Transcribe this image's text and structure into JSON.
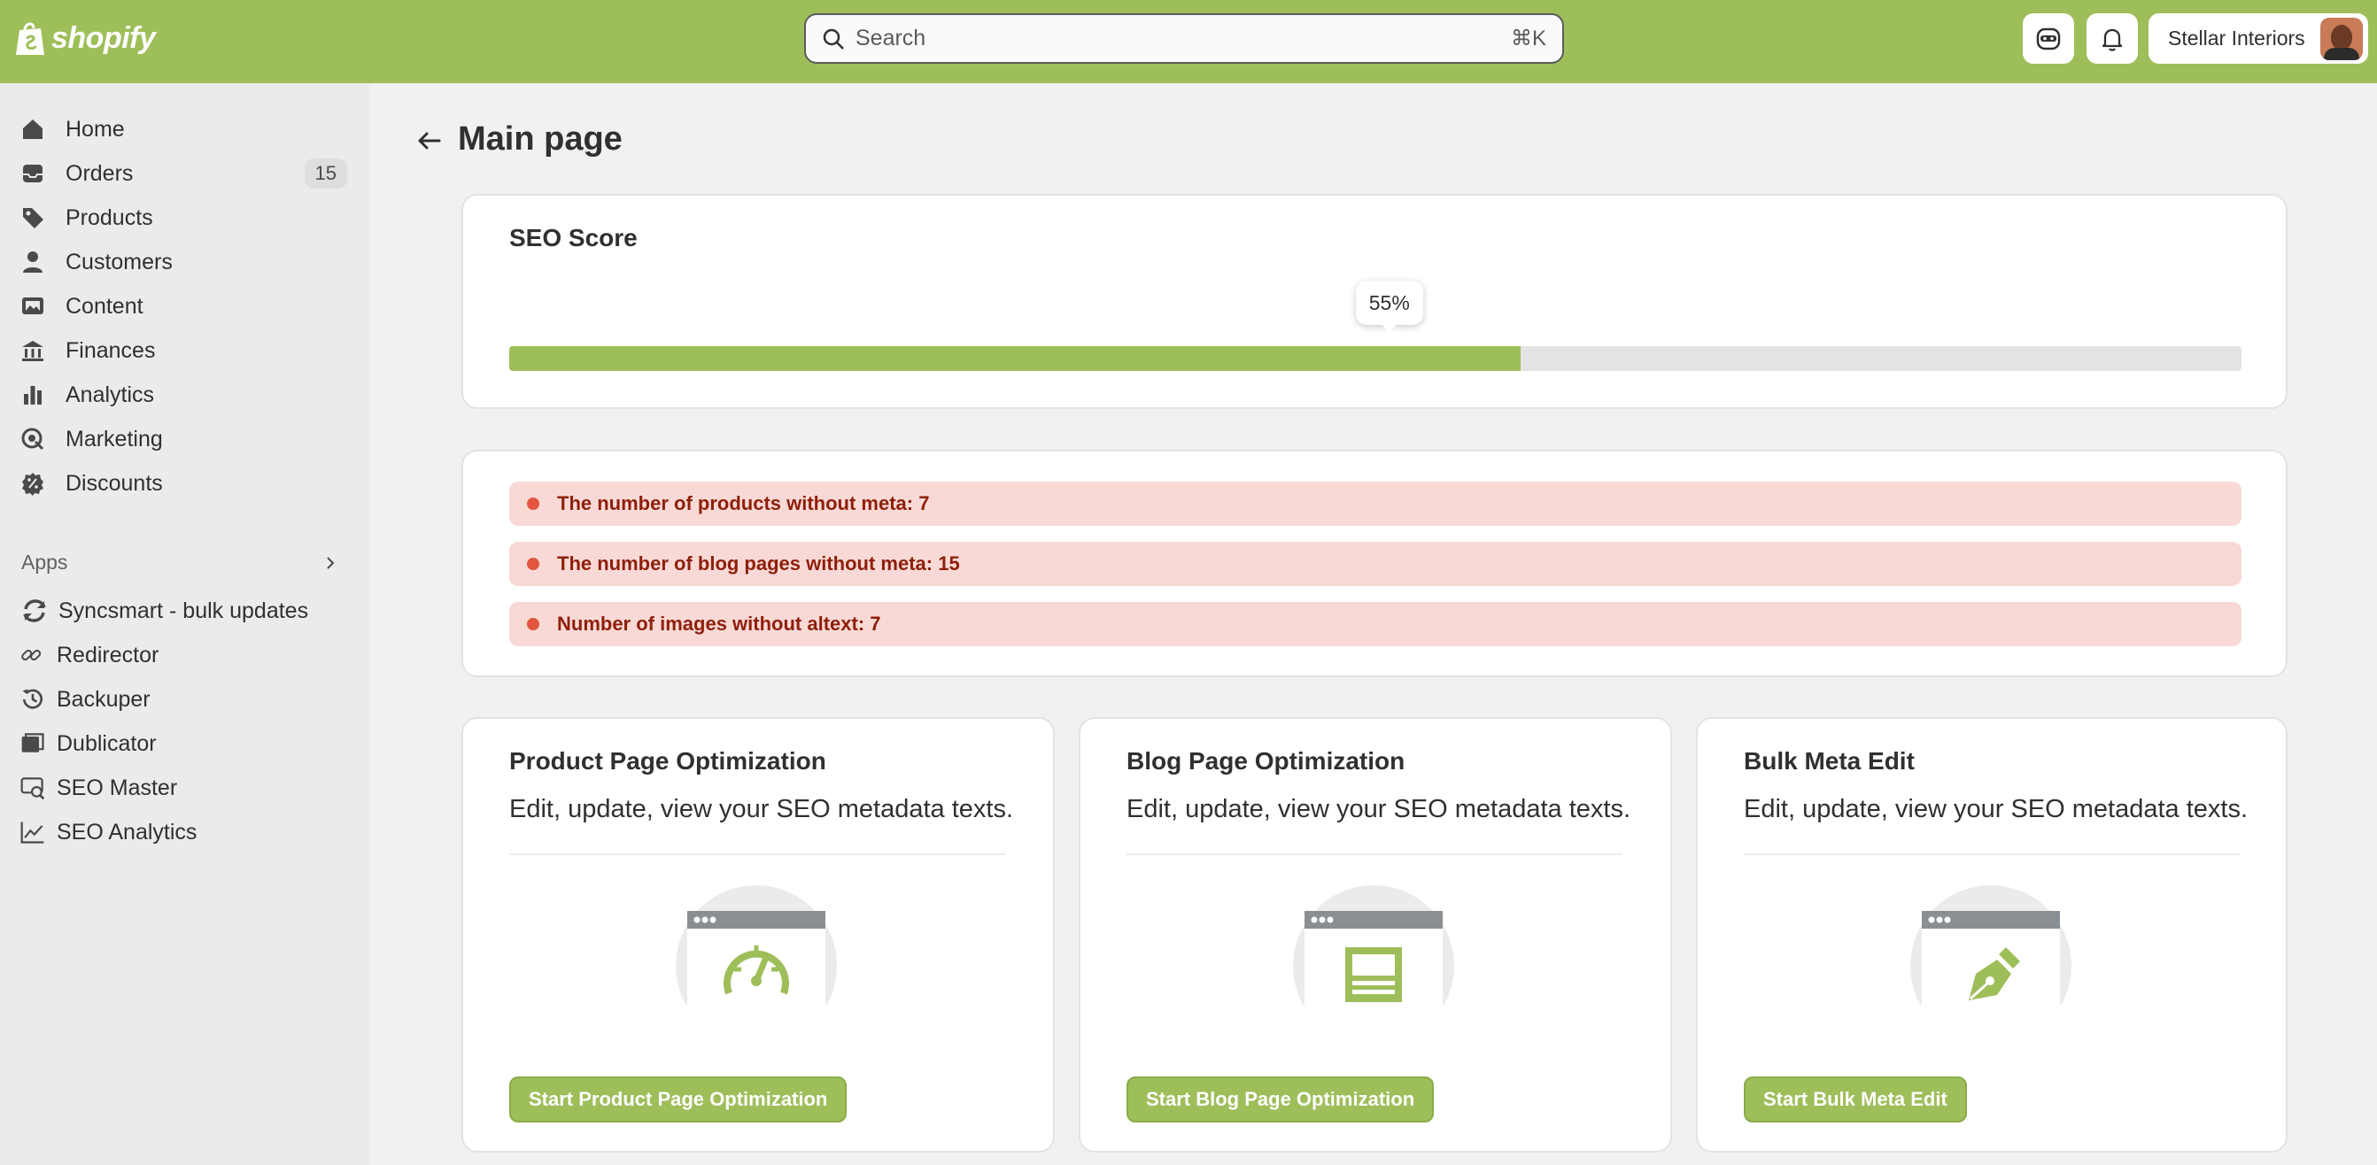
{
  "topbar": {
    "brand": "shopify",
    "search_placeholder": "Search",
    "search_shortcut": "⌘K",
    "store_name": "Stellar Interiors",
    "brand_color": "#9ebe5a"
  },
  "sidebar": {
    "items": [
      {
        "label": "Home",
        "icon": "home-icon"
      },
      {
        "label": "Orders",
        "icon": "inbox-icon",
        "count": "15"
      },
      {
        "label": "Products",
        "icon": "tag-icon"
      },
      {
        "label": "Customers",
        "icon": "person-icon"
      },
      {
        "label": "Content",
        "icon": "image-icon"
      },
      {
        "label": "Finances",
        "icon": "bank-icon"
      },
      {
        "label": "Analytics",
        "icon": "bar-chart-icon"
      },
      {
        "label": "Marketing",
        "icon": "target-icon"
      },
      {
        "label": "Discounts",
        "icon": "discount-icon"
      }
    ],
    "apps_label": "Apps",
    "apps": [
      {
        "label": "Syncsmart - bulk updates",
        "icon": "sync-icon"
      },
      {
        "label": "Redirector",
        "icon": "link-icon"
      },
      {
        "label": "Backuper",
        "icon": "history-icon"
      },
      {
        "label": "Dublicator",
        "icon": "copy-icon"
      },
      {
        "label": "SEO Master",
        "icon": "search-doc-icon"
      },
      {
        "label": "SEO Analytics",
        "icon": "trend-icon"
      }
    ]
  },
  "main": {
    "title": "Main page",
    "seo_score": {
      "title": "SEO Score",
      "percent_label": "55%",
      "percent_value": 0.584
    },
    "alerts": [
      "The number of products without meta: 7",
      "The number of blog pages without meta: 15",
      "Number of images without altext: 7"
    ],
    "cards": [
      {
        "title": "Product Page Optimization",
        "description": "Edit, update, view your SEO metadata texts.",
        "button": "Start Product Page Optimization",
        "icon": "speedometer-icon"
      },
      {
        "title": "Blog Page Optimization",
        "description": "Edit, update, view your SEO metadata texts.",
        "button": "Start Blog Page Optimization",
        "icon": "blog-page-icon"
      },
      {
        "title": "Bulk Meta Edit",
        "description": "Edit, update, view your SEO metadata texts.",
        "button": "Start Bulk Meta Edit",
        "icon": "pen-nib-icon"
      }
    ]
  }
}
